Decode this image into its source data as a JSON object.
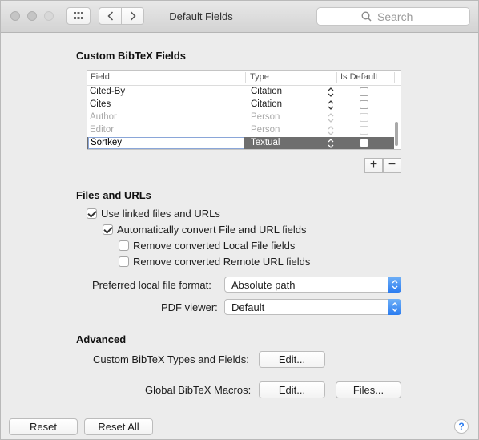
{
  "window": {
    "title": "Default Fields"
  },
  "search": {
    "placeholder": "Search"
  },
  "custom_fields": {
    "title": "Custom BibTeX Fields",
    "headers": {
      "field": "Field",
      "type": "Type",
      "is_default": "Is Default"
    },
    "rows": [
      {
        "field": "Cited-By",
        "type": "Citation",
        "enabled": true,
        "selected": false,
        "is_default": false
      },
      {
        "field": "Cites",
        "type": "Citation",
        "enabled": true,
        "selected": false,
        "is_default": false
      },
      {
        "field": "Author",
        "type": "Person",
        "enabled": false,
        "selected": false,
        "is_default": false
      },
      {
        "field": "Editor",
        "type": "Person",
        "enabled": false,
        "selected": false,
        "is_default": false
      },
      {
        "field": "Sortkey",
        "type": "Textual",
        "enabled": true,
        "selected": true,
        "is_default": false
      }
    ],
    "add_label": "+",
    "remove_label": "−"
  },
  "files_urls": {
    "title": "Files and URLs",
    "use_linked": {
      "label": "Use linked files and URLs",
      "checked": true
    },
    "auto_convert": {
      "label": "Automatically convert File and URL fields",
      "checked": true
    },
    "remove_local": {
      "label": "Remove converted Local File fields",
      "checked": false
    },
    "remove_remote": {
      "label": "Remove converted Remote URL fields",
      "checked": false
    },
    "file_format_label": "Preferred local file format:",
    "file_format_value": "Absolute path",
    "pdf_viewer_label": "PDF viewer:",
    "pdf_viewer_value": "Default"
  },
  "advanced": {
    "title": "Advanced",
    "types_label": "Custom BibTeX Types and Fields:",
    "types_edit": "Edit...",
    "macros_label": "Global BibTeX Macros:",
    "macros_edit": "Edit...",
    "macros_files": "Files..."
  },
  "footer": {
    "reset": "Reset",
    "reset_all": "Reset All",
    "help": "?"
  },
  "colors": {
    "accent": "#2b7cf0",
    "selected_row": "#6e6e6e"
  }
}
